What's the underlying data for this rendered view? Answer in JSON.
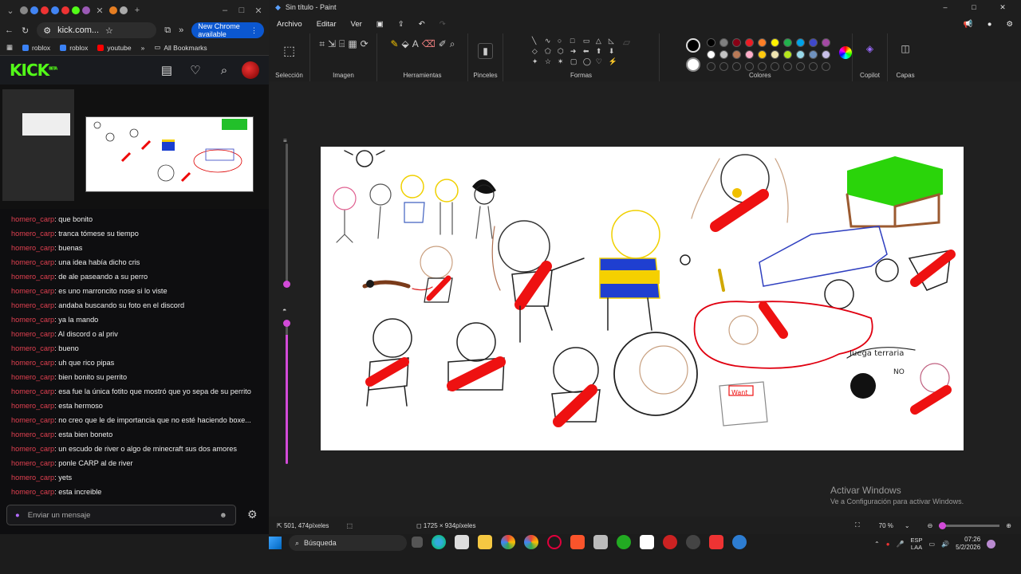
{
  "chrome": {
    "url": "kick.com...",
    "new_chrome": "New Chrome available",
    "bookmarks": [
      {
        "label": "roblox",
        "color": "#3b82f6"
      },
      {
        "label": "roblox",
        "color": "#3b82f6"
      },
      {
        "label": "youtube",
        "color": "#ff0000"
      }
    ],
    "all_bookmarks": "All Bookmarks"
  },
  "kick": {
    "logo": "KICK",
    "beta": "BETA",
    "chat": [
      {
        "user": "homero_carp",
        "text": ": que bonito"
      },
      {
        "user": "homero_carp",
        "text": ": tranca tómese su tiempo"
      },
      {
        "user": "homero_carp",
        "text": ": buenas"
      },
      {
        "user": "homero_carp",
        "text": ": una idea había dicho cris"
      },
      {
        "user": "homero_carp",
        "text": ": de ale paseando a su perro"
      },
      {
        "user": "homero_carp",
        "text": ": es uno marroncito nose si lo viste"
      },
      {
        "user": "homero_carp",
        "text": ": andaba buscando su foto en el discord"
      },
      {
        "user": "homero_carp",
        "text": ": ya la mando"
      },
      {
        "user": "homero_carp",
        "text": ": Al discord o al priv"
      },
      {
        "user": "homero_carp",
        "text": ": bueno"
      },
      {
        "user": "homero_carp",
        "text": ": uh que rico pipas"
      },
      {
        "user": "homero_carp",
        "text": ": bien bonito su perrito"
      },
      {
        "user": "homero_carp",
        "text": ": esa fue la única fotito que mostró que yo sepa de su perrito"
      },
      {
        "user": "homero_carp",
        "text": ": esta hermoso"
      },
      {
        "user": "homero_carp",
        "text": ": no creo que le de importancia que no esté haciendo boxe..."
      },
      {
        "user": "homero_carp",
        "text": ": esta bien boneto"
      },
      {
        "user": "homero_carp",
        "text": ": un escudo de river o algo de minecraft sus dos amores"
      },
      {
        "user": "homero_carp",
        "text": ": ponle CARP al de river"
      },
      {
        "user": "homero_carp",
        "text": ": yets"
      },
      {
        "user": "homero_carp",
        "text": ": esta increible"
      }
    ],
    "input_placeholder": "Enviar un mensaje"
  },
  "paint": {
    "title": "Sin título - Paint",
    "menu": [
      "Archivo",
      "Editar",
      "Ver"
    ],
    "groups": {
      "seleccion": "Selección",
      "imagen": "Imagen",
      "herramientas": "Herramientas",
      "pinceles": "Pinceles",
      "formas": "Formas",
      "colores": "Colores",
      "copilot": "Copilot",
      "capas": "Capas"
    },
    "palette": [
      "#000000",
      "#7f7f7f",
      "#880015",
      "#ed1c24",
      "#ff7f27",
      "#fff200",
      "#22b14c",
      "#00a2e8",
      "#3f48cc",
      "#a349a4",
      "#ffffff",
      "#c3c3c3",
      "#b97a57",
      "#ffaec9",
      "#ffc90e",
      "#efe4b0",
      "#b5e61d",
      "#99d9ea",
      "#7092be",
      "#c8bfe7"
    ],
    "activate_title": "Activar Windows",
    "activate_sub": "Ve a Configuración para activar Windows.",
    "status_pos": "501, 474píxeles",
    "status_size": "1725 × 934píxeles",
    "zoom": "70 %"
  },
  "taskbar": {
    "search": "Búsqueda",
    "lang1": "ESP",
    "lang2": "LAA",
    "time": "07:26",
    "date": "5/2/2026"
  }
}
